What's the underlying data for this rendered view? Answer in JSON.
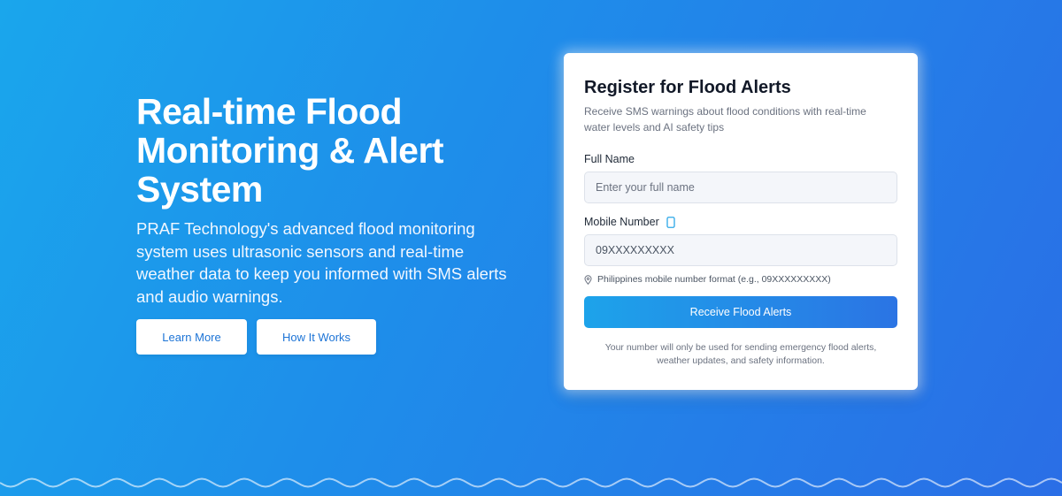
{
  "hero": {
    "title_line1": "Real-time Flood",
    "title_line2": "Monitoring & Alert",
    "title_line3": "System",
    "description": "PRAF Technology's advanced flood monitoring system uses ultrasonic sensors and real-time weather data to keep you informed with SMS alerts and audio warnings.",
    "learn_more_label": "Learn More",
    "how_it_works_label": "How It Works"
  },
  "form": {
    "title": "Register for Flood Alerts",
    "subtitle": "Receive SMS warnings about flood conditions with real-time water levels and AI safety tips",
    "full_name_label": "Full Name",
    "full_name_placeholder": "Enter your full name",
    "mobile_label": "Mobile Number",
    "mobile_value": "09XXXXXXXXX",
    "mobile_hint": "Philippines mobile number format (e.g., 09XXXXXXXXX)",
    "submit_label": "Receive Flood Alerts",
    "privacy_note": "Your number will only be used for sending emergency flood alerts, weather updates, and safety information."
  },
  "icons": {
    "phone": "phone-icon",
    "pin": "map-pin-icon"
  },
  "colors": {
    "accent": "#1e8eea",
    "button_text": "#1d74d6",
    "phone_icon": "#2ba7e8"
  }
}
